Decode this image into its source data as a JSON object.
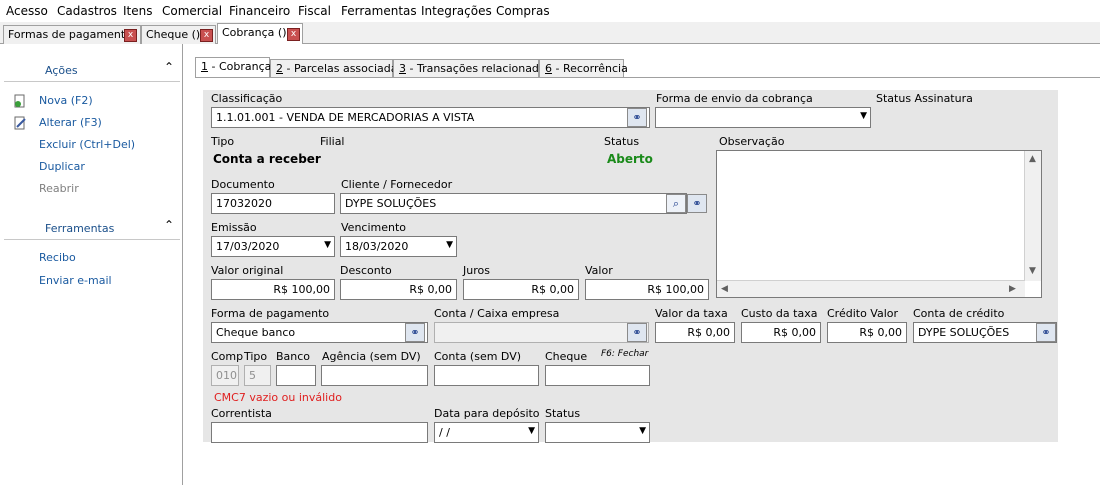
{
  "menu": [
    "Acesso",
    "Cadastros",
    "Itens",
    "Comercial",
    "Financeiro",
    "Fiscal",
    "Ferramentas",
    "Integrações",
    "Compras"
  ],
  "doc_tabs": [
    {
      "label": "Formas de pagamento"
    },
    {
      "label": "Cheque ()"
    },
    {
      "label": "Cobrança ()"
    }
  ],
  "close_glyph": "x",
  "sidebar": {
    "acoes_title": "Ações",
    "acoes": [
      "Nova (F2)",
      "Alterar (F3)",
      "Excluir (Ctrl+Del)",
      "Duplicar",
      "Reabrir"
    ],
    "ferramentas_title": "Ferramentas",
    "ferramentas": [
      "Recibo",
      "Enviar e-mail"
    ]
  },
  "form_tabs": [
    {
      "key": "1",
      "label": " - Cobrança"
    },
    {
      "key": "2",
      "label": " - Parcelas associadas"
    },
    {
      "key": "3",
      "label": " - Transações relacionadas"
    },
    {
      "key": "6",
      "label": " - Recorrência"
    }
  ],
  "form": {
    "classificacao_label": "Classificação",
    "classificacao_value": "1.1.01.001 - VENDA DE MERCADORIAS A VISTA",
    "forma_envio_label": "Forma de envio da cobrança",
    "forma_envio_value": "",
    "status_assinatura_label": "Status Assinatura",
    "tipo_label": "Tipo",
    "tipo_value": "Conta a receber",
    "filial_label": "Filial",
    "status_label": "Status",
    "status_value": "Aberto",
    "observacao_label": "Observação",
    "documento_label": "Documento",
    "documento_value": "17032020",
    "cliente_label": "Cliente / Fornecedor",
    "cliente_value": "DYPE SOLUÇÕES",
    "emissao_label": "Emissão",
    "emissao_value": "17/03/2020",
    "vencimento_label": "Vencimento",
    "vencimento_value": "18/03/2020",
    "valor_original_label": "Valor original",
    "valor_original_value": "R$ 100,00",
    "desconto_label": "Desconto",
    "desconto_value": "R$ 0,00",
    "juros_label": "Juros",
    "juros_value": "R$ 0,00",
    "valor_label": "Valor",
    "valor_value": "R$ 100,00",
    "forma_pagamento_label": "Forma de pagamento",
    "forma_pagamento_value": "Cheque banco",
    "conta_caixa_label": "Conta / Caixa empresa",
    "conta_caixa_value": "",
    "valor_taxa_label": "Valor da taxa",
    "valor_taxa_value": "R$ 0,00",
    "custo_taxa_label": "Custo da taxa",
    "custo_taxa_value": "R$ 0,00",
    "credito_valor_label": "Crédito Valor",
    "credito_valor_value": "R$ 0,00",
    "conta_credito_label": "Conta de crédito",
    "conta_credito_value": "DYPE SOLUÇÕES",
    "comp_label": "Comp",
    "comp_value": "010",
    "tipo2_label": "Tipo",
    "tipo2_value": "5",
    "banco_label": "Banco",
    "agencia_label": "Agência (sem DV)",
    "conta_sem_dv_label": "Conta (sem DV)",
    "cheque_label": "Cheque",
    "f6_label": "F6: Fechar",
    "cmc7_error": "CMC7 vazio ou inválido",
    "correntista_label": "Correntista",
    "data_deposito_label": "Data para depósito",
    "data_deposito_value": " /  /",
    "status2_label": "Status"
  },
  "colors": {
    "link": "#1a5aa0",
    "status_ok": "#1a8a1a",
    "error": "#e02020",
    "panel": "#e6e6e6"
  }
}
